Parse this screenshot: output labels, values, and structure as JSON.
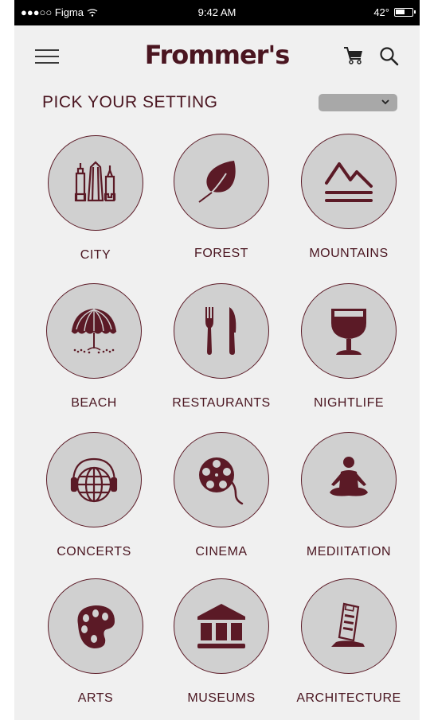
{
  "status_bar": {
    "carrier": "●●●○○ Figma",
    "wifi_icon": "wifi-icon",
    "time": "9:42 AM",
    "temperature": "42°",
    "battery_icon": "battery-icon"
  },
  "header": {
    "menu_icon": "hamburger-menu-icon",
    "logo": "Frommer's",
    "cart_icon": "shopping-cart-icon",
    "search_icon": "search-icon"
  },
  "section": {
    "title": "PICK YOUR SETTING",
    "dropdown_value": "",
    "dropdown_icon": "chevron-down-icon"
  },
  "colors": {
    "brand": "#5b1a26",
    "circle_fill": "#d0d0d0",
    "background": "#f0f0f0",
    "dropdown": "#a8a8a8"
  },
  "categories": [
    {
      "label": "CITY",
      "icon": "city-skyline-icon"
    },
    {
      "label": "FOREST",
      "icon": "leaf-icon"
    },
    {
      "label": "MOUNTAINS",
      "icon": "mountains-icon"
    },
    {
      "label": "BEACH",
      "icon": "beach-umbrella-icon"
    },
    {
      "label": "RESTAURANTS",
      "icon": "fork-knife-icon"
    },
    {
      "label": "NIGHTLIFE",
      "icon": "wine-glass-icon"
    },
    {
      "label": "CONCERTS",
      "icon": "globe-headphones-icon"
    },
    {
      "label": "CINEMA",
      "icon": "film-reel-icon"
    },
    {
      "label": "MEDIITATION",
      "icon": "meditation-icon"
    },
    {
      "label": "ARTS",
      "icon": "palette-icon"
    },
    {
      "label": "MUSEUMS",
      "icon": "museum-icon"
    },
    {
      "label": "ARCHITECTURE",
      "icon": "leaning-tower-icon"
    }
  ]
}
